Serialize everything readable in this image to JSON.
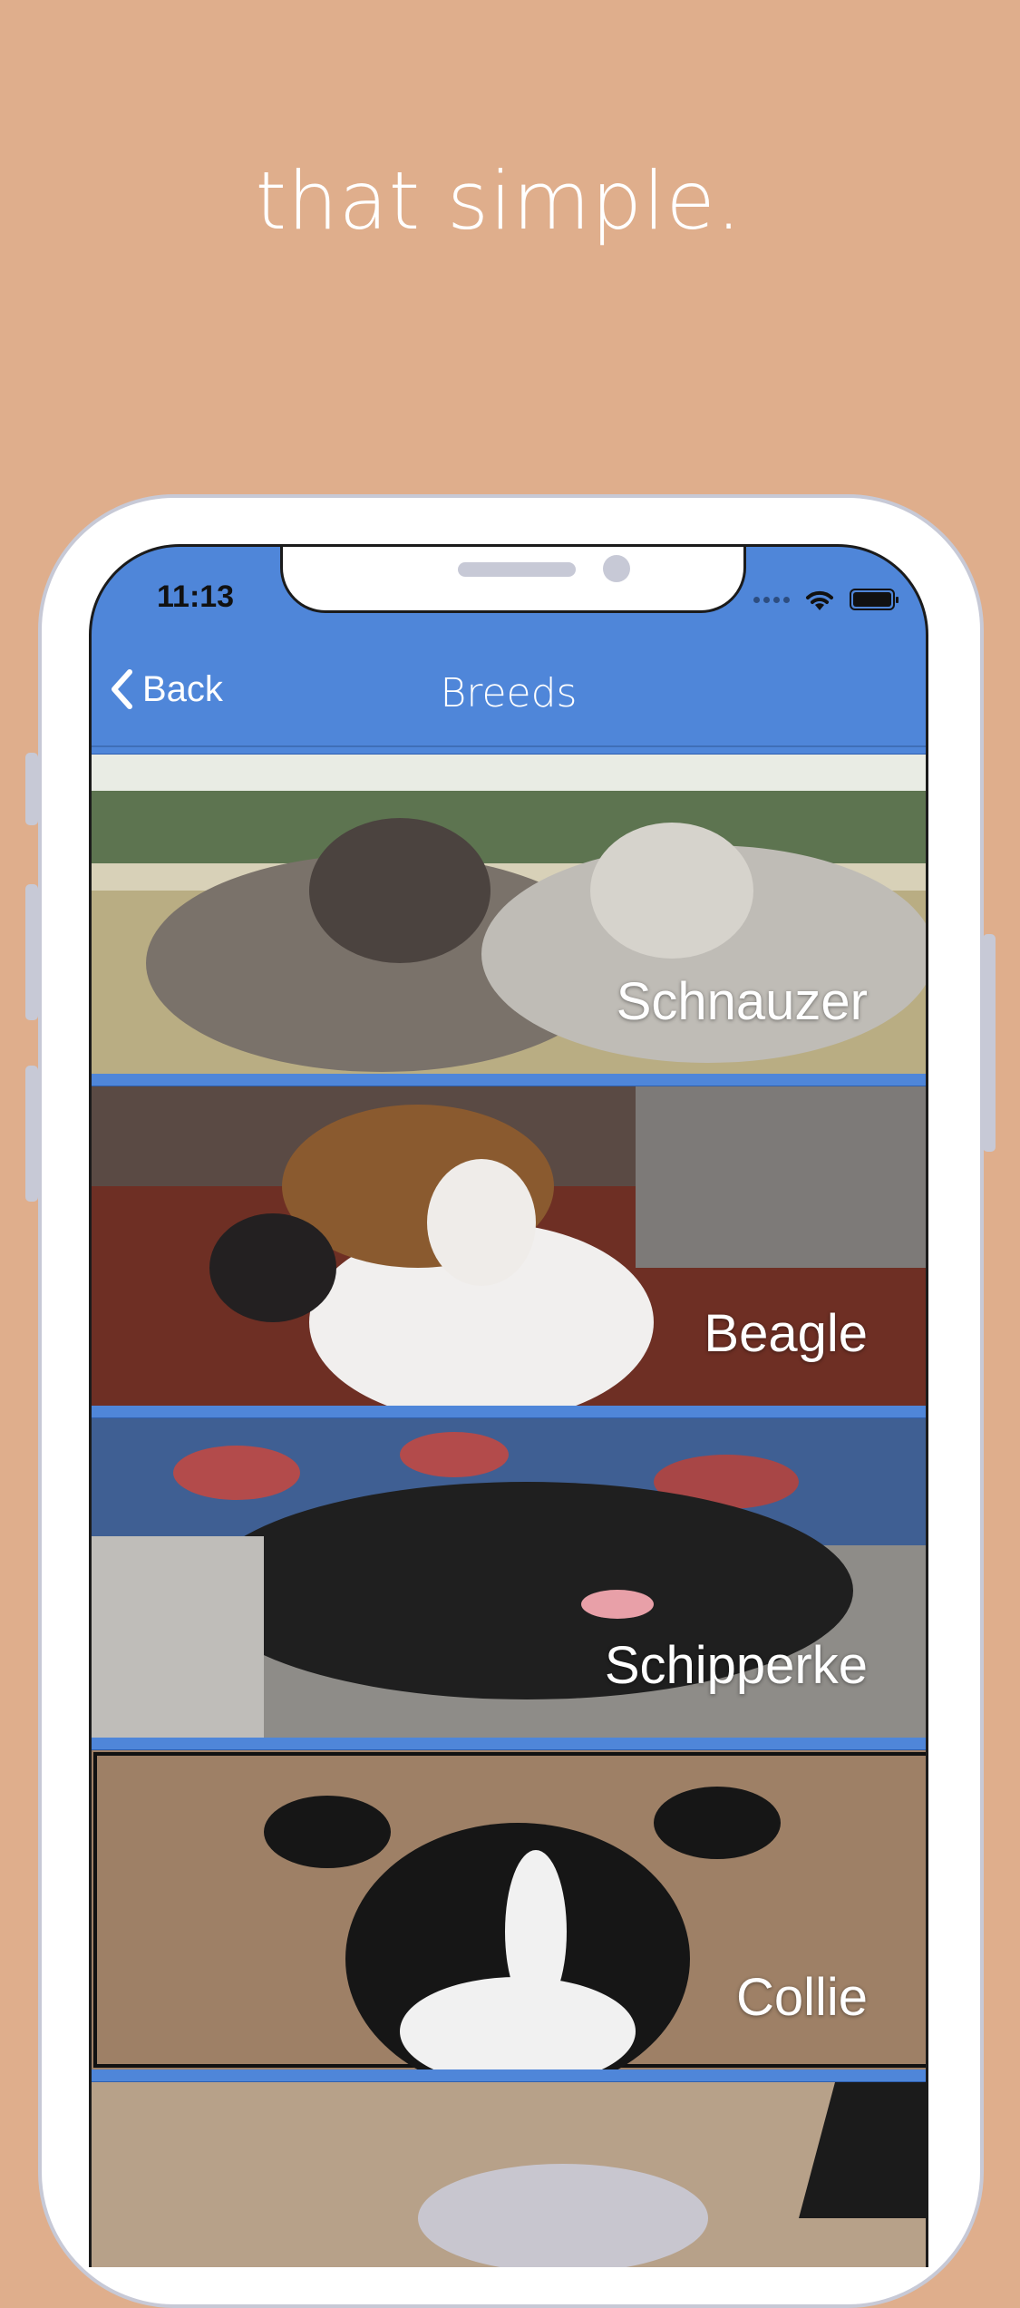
{
  "tagline": "that simple.",
  "status_bar": {
    "time": "11:13"
  },
  "nav": {
    "back_label": "Back",
    "title": "Breeds"
  },
  "breeds": [
    {
      "name": "Schnauzer"
    },
    {
      "name": "Beagle"
    },
    {
      "name": "Schipperke"
    },
    {
      "name": "Collie"
    },
    {
      "name": ""
    }
  ],
  "colors": {
    "background": "#DFAE8C",
    "accent": "#4F86D9"
  }
}
